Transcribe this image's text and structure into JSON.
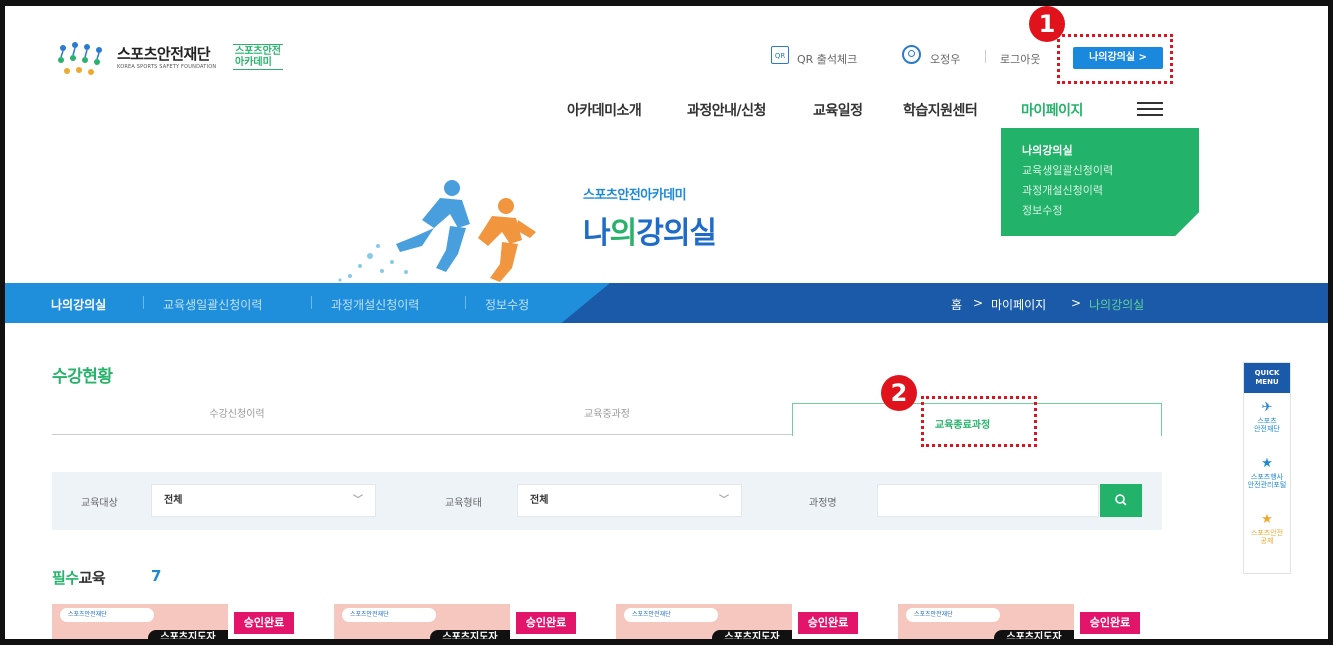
{
  "header": {
    "logo_name": "스포츠안전재단",
    "logo_sub": "KOREA SPORTS SAFETY FOUNDATION",
    "logo_academy_line1": "스포츠안전",
    "logo_academy_line2": "아카데미",
    "qr_icon": "QR",
    "qr_label": "QR 출석체크",
    "user_name": "오정우",
    "logout": "로그아웃",
    "my_classroom_button": "나의강의실 >"
  },
  "nav": {
    "items": [
      "아카데미소개",
      "과정안내/신청",
      "교육일정",
      "학습지원센터",
      "마이페이지"
    ],
    "active_index": 4
  },
  "dropdown": {
    "items": [
      "나의강의실",
      "교육생일괄신청이력",
      "과정개설신청이력",
      "정보수정"
    ]
  },
  "hero": {
    "subtitle": "스포츠안전아카데미",
    "title_part1": "나",
    "title_part2": "의",
    "title_part3": "강의실"
  },
  "subnav": {
    "items": [
      "나의강의실",
      "교육생일괄신청이력",
      "과정개설신청이력",
      "정보수정"
    ],
    "breadcrumb": [
      "홈",
      "마이페이지",
      "나의강의실"
    ],
    "breadcrumb_sep": ">"
  },
  "content": {
    "section_title": "수강현황",
    "tabs": [
      "수강신청이력",
      "교육중과정",
      "교육종료과정"
    ],
    "active_tab": 2
  },
  "search": {
    "target_label": "교육대상",
    "target_value": "전체",
    "type_label": "교육형태",
    "type_value": "전체",
    "course_label": "과정명",
    "course_value": ""
  },
  "required": {
    "title_part1": "필수",
    "title_part2": "교육",
    "count": "7"
  },
  "cards": [
    {
      "badge": "승인완료",
      "tag": "스포츠지도자"
    },
    {
      "badge": "승인완료",
      "tag": "스포츠지도자"
    },
    {
      "badge": "승인완료",
      "tag": "스포츠지도자"
    },
    {
      "badge": "승인완료",
      "tag": "스포츠지도자"
    }
  ],
  "quick_menu": {
    "head_line1": "QUICK",
    "head_line2": "MENU",
    "items": [
      {
        "line1": "스포츠",
        "line2": "안전재단"
      },
      {
        "line1": "스포츠행사",
        "line2": "안전관리포털"
      },
      {
        "line1": "스포츠안전",
        "line2": "공제"
      }
    ]
  },
  "annotations": {
    "marker1": "1",
    "marker2": "2",
    "color": "#e0121b"
  },
  "colors": {
    "green": "#27b36b",
    "blue": "#1e8ad6",
    "dark_blue": "#1a5aa8",
    "badge_pink": "#e2156b"
  }
}
